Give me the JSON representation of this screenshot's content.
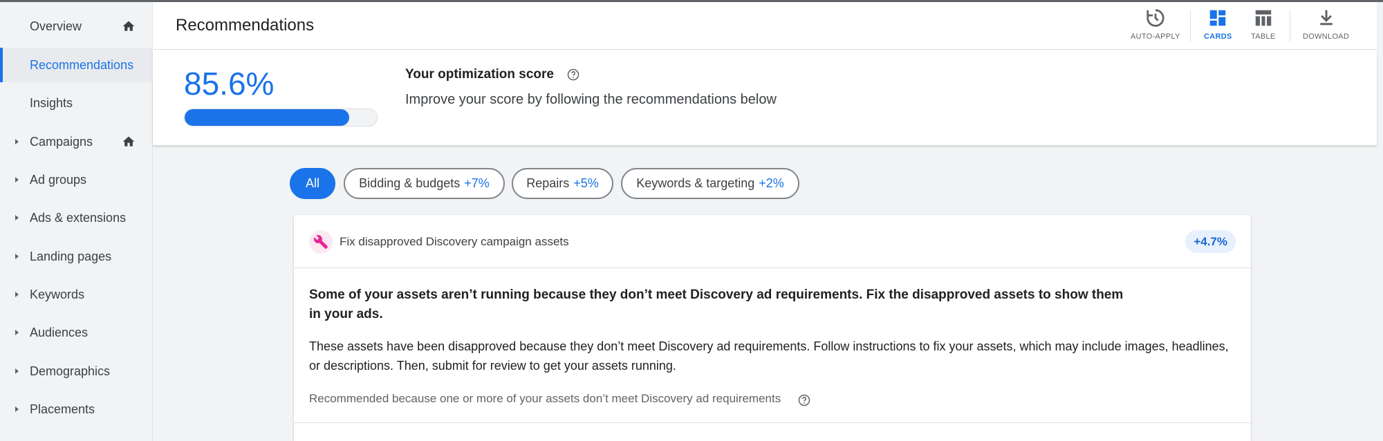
{
  "sidebar": {
    "items": [
      {
        "label": "Overview"
      },
      {
        "label": "Recommendations"
      },
      {
        "label": "Insights"
      },
      {
        "label": "Campaigns"
      },
      {
        "label": "Ad groups"
      },
      {
        "label": "Ads & extensions"
      },
      {
        "label": "Landing pages"
      },
      {
        "label": "Keywords"
      },
      {
        "label": "Audiences"
      },
      {
        "label": "Demographics"
      },
      {
        "label": "Placements"
      }
    ]
  },
  "header": {
    "title": "Recommendations",
    "tools": {
      "auto_apply": "AUTO-APPLY",
      "cards": "CARDS",
      "table": "TABLE",
      "download": "DOWNLOAD"
    }
  },
  "score": {
    "value": "85.6%",
    "progress_fraction": 0.856,
    "title": "Your optimization score",
    "subtitle": "Improve your score by following the recommendations below"
  },
  "filters": {
    "all": "All",
    "bidding": {
      "label": "Bidding & budgets",
      "pct": "+7%"
    },
    "repairs": {
      "label": "Repairs",
      "pct": "+5%"
    },
    "keywords": {
      "label": "Keywords & targeting",
      "pct": "+2%"
    }
  },
  "card": {
    "title": "Fix disapproved Discovery campaign assets",
    "impact": "+4.7%",
    "headline": "Some of your assets aren’t running because they don’t meet Discovery ad requirements. Fix the disapproved assets to show them in your ads.",
    "description": "These assets have been disapproved because they don’t meet Discovery ad requirements. Follow instructions to fix your assets, which may include images, headlines, or descriptions. Then, submit for review to get your assets running.",
    "reason": "Recommended because one or more of your assets don’t meet Discovery ad requirements"
  },
  "colors": {
    "accent": "#1a73e8",
    "wrench": "#e52592"
  }
}
